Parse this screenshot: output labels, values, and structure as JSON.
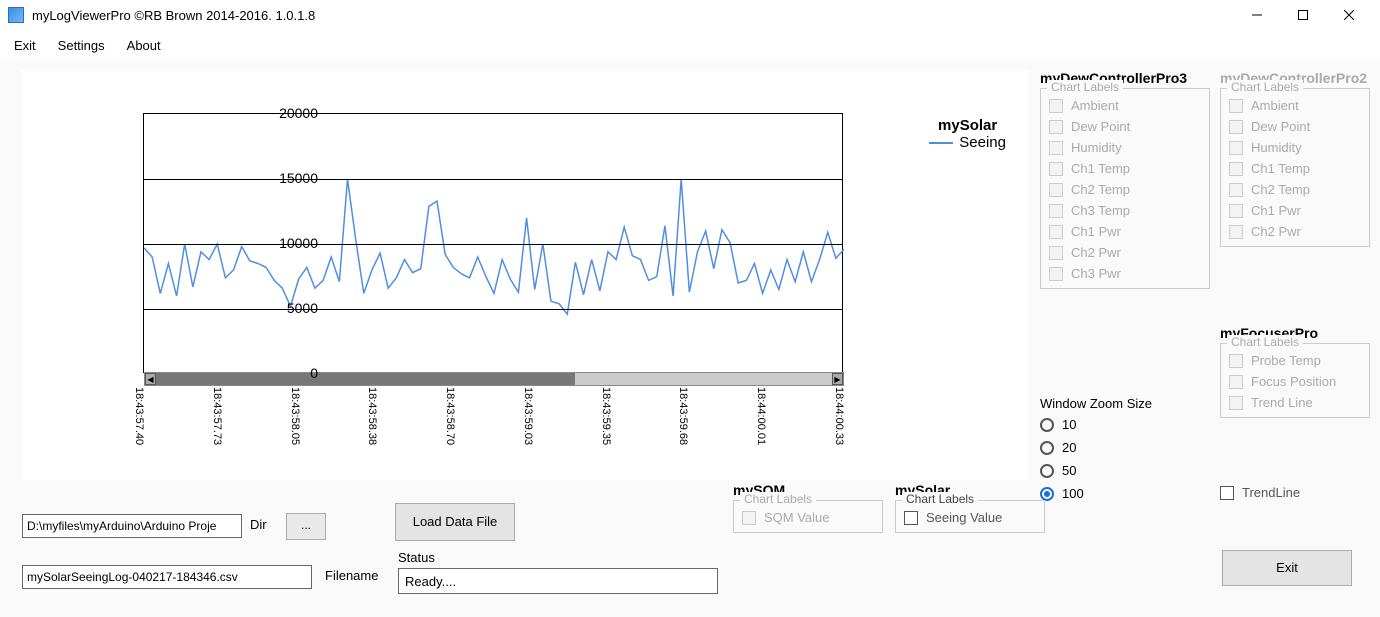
{
  "titlebar": {
    "title": "myLogViewerPro ©RB Brown 2014-2016. 1.0.1.8"
  },
  "menu": {
    "items": [
      "Exit",
      "Settings",
      "About"
    ]
  },
  "chart_data": {
    "type": "line",
    "series": [
      {
        "name": "Seeing",
        "values": [
          9700,
          9000,
          6200,
          8500,
          6000,
          10000,
          6700,
          9400,
          8800,
          10000,
          7400,
          8000,
          9800,
          8700,
          8500,
          8200,
          7200,
          6600,
          5200,
          7300,
          8200,
          6600,
          7200,
          9000,
          7100,
          15000,
          10400,
          6200,
          8000,
          9300,
          6600,
          7400,
          8800,
          7800,
          8100,
          12900,
          13300,
          9200,
          8200,
          7700,
          7400,
          9000,
          7500,
          6200,
          8800,
          7300,
          6300,
          12000,
          6500,
          10000,
          5600,
          5400,
          4600,
          8600,
          6100,
          8800,
          6400,
          9400,
          8800,
          11300,
          9100,
          8800,
          7200,
          7500,
          11400,
          6000,
          15000,
          6300,
          9400,
          11000,
          8100,
          11100,
          10100,
          7000,
          7200,
          8500,
          6200,
          8000,
          6500,
          8800,
          7100,
          9400,
          7100,
          8800,
          10900,
          8900,
          9600
        ]
      }
    ],
    "title": "mySolar",
    "xlabel": "",
    "ylabel": "",
    "ylim": [
      0,
      20000
    ],
    "yticks": [
      0,
      5000,
      10000,
      15000,
      20000
    ],
    "xticks": [
      "18:43:57.40",
      "18:43:57.73",
      "18:43:58.05",
      "18:43:58.38",
      "18:43:58.70",
      "18:43:59.03",
      "18:43:59.35",
      "18:43:59.68",
      "18:44:00.01",
      "18:44:00.33"
    ],
    "series_color": "#4f8fe0"
  },
  "panels": {
    "dew3": {
      "title": "myDewControllerPro3",
      "group": "Chart Labels",
      "items": [
        "Ambient",
        "Dew Point",
        "Humidity",
        "Ch1 Temp",
        "Ch2 Temp",
        "Ch3 Temp",
        "Ch1 Pwr",
        "Ch2 Pwr",
        "Ch3 Pwr"
      ],
      "enabled": false
    },
    "dew2": {
      "title": "myDewControllerPro2",
      "group": "Chart Labels",
      "items": [
        "Ambient",
        "Dew Point",
        "Humidity",
        "Ch1 Temp",
        "Ch2 Temp",
        "Ch1 Pwr",
        "Ch2 Pwr"
      ],
      "enabled": false
    },
    "focuser": {
      "title": "myFocuserPro",
      "group": "Chart Labels",
      "items": [
        "Probe Temp",
        "Focus Position",
        "Trend Line"
      ],
      "enabled": false
    },
    "sqm": {
      "title": "mySQM",
      "group": "Chart Labels",
      "items": [
        "SQM Value"
      ],
      "enabled": false
    },
    "solar": {
      "title": "mySolar",
      "group": "Chart Labels",
      "items": [
        "Seeing Value"
      ],
      "enabled": true
    },
    "trendline_chk": "TrendLine"
  },
  "zoom": {
    "title": "Window Zoom Size",
    "options": [
      "10",
      "20",
      "50",
      "100"
    ],
    "selected": "100"
  },
  "controls": {
    "dir_value": "D:\\myfiles\\myArduino\\Arduino Proje",
    "dir_label": "Dir",
    "dir_browse": "...",
    "file_value": "mySolarSeeingLog-040217-184346.csv",
    "file_label": "Filename",
    "load_button": "Load Data File",
    "status_label": "Status",
    "status_value": "Ready....",
    "exit_button": "Exit"
  }
}
